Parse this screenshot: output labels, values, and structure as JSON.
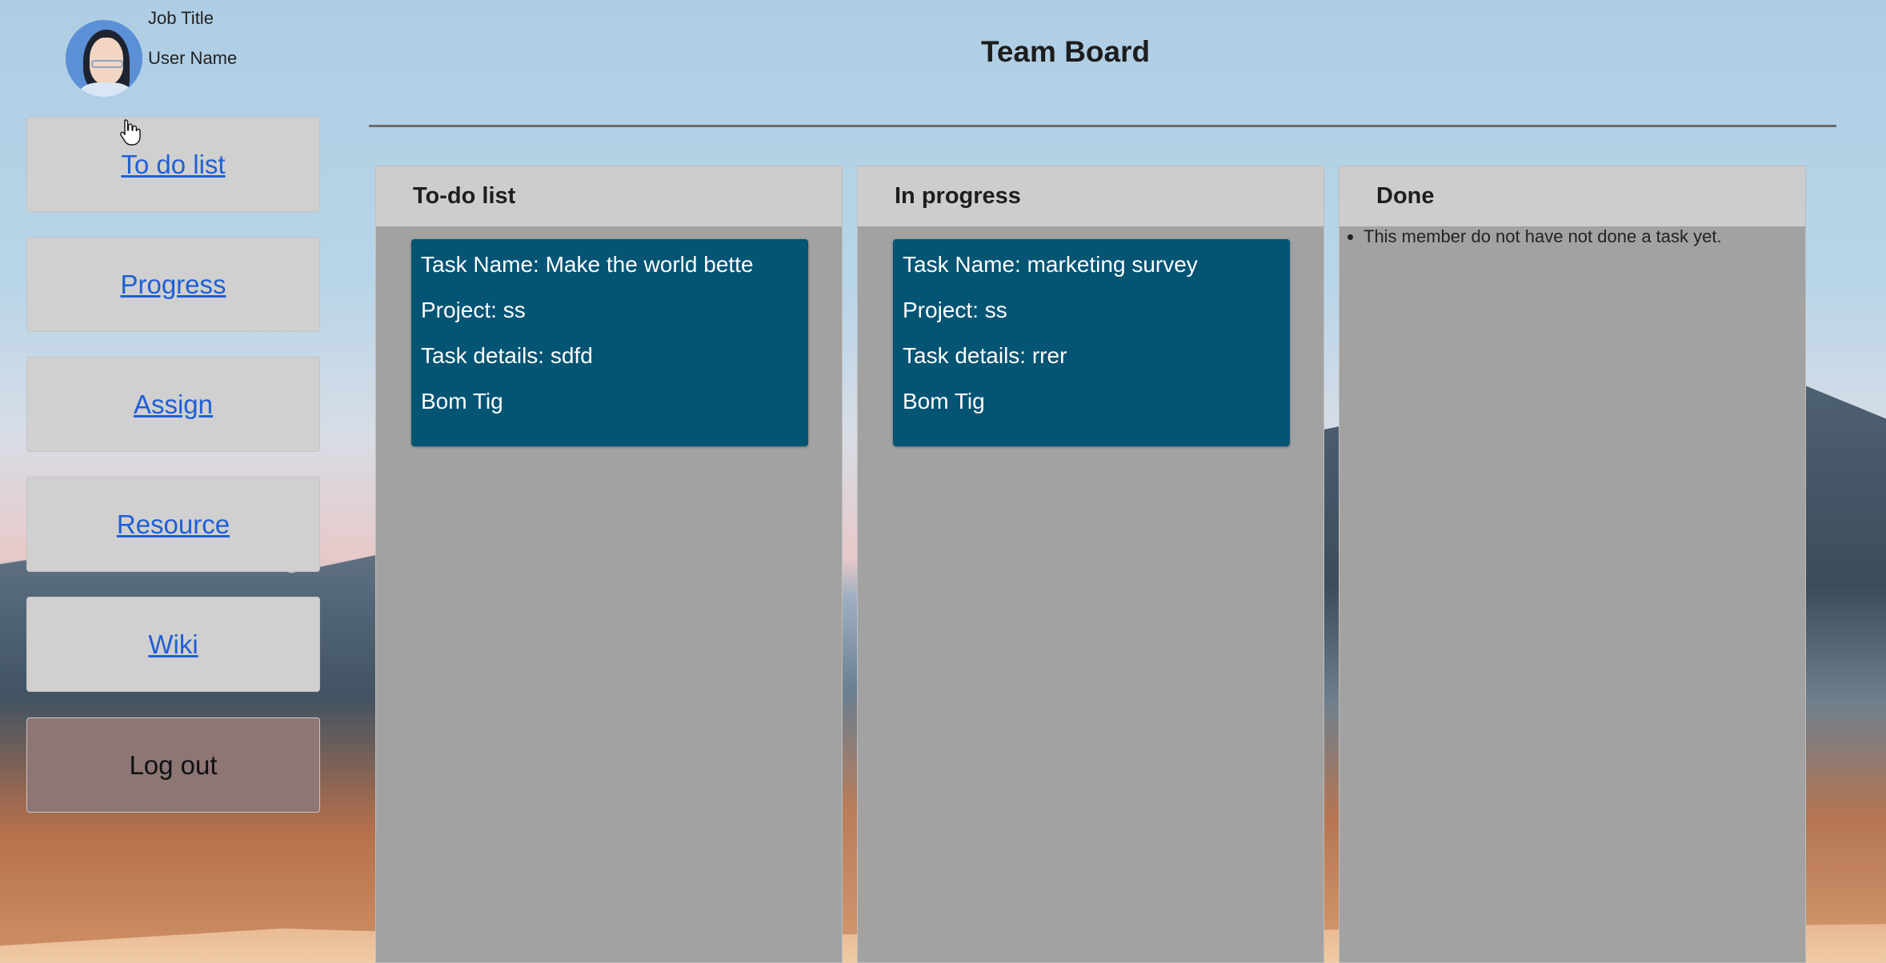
{
  "profile": {
    "job_title": "Job Title",
    "user_name": "User Name"
  },
  "sidebar": {
    "items": [
      {
        "label": "To do list"
      },
      {
        "label": "Progress"
      },
      {
        "label": "Assign"
      },
      {
        "label": "Resource"
      },
      {
        "label": "Wiki"
      }
    ],
    "logout_label": "Log out"
  },
  "header": {
    "title": "Team Board"
  },
  "board": {
    "columns": [
      {
        "title": "To-do list",
        "tasks": [
          {
            "name": "Task Name: Make the world bette",
            "project": "Project: ss",
            "details": "Task details: sdfd",
            "assignee": "Bom Tig"
          }
        ]
      },
      {
        "title": "In progress",
        "tasks": [
          {
            "name": "Task Name: marketing survey",
            "project": "Project: ss",
            "details": "Task details: rrer",
            "assignee": "Bom Tig"
          }
        ]
      },
      {
        "title": "Done",
        "empty_message": "This member do not have not done a task yet."
      }
    ]
  },
  "colors": {
    "card_bg": "#045474",
    "column_bg": "#a2a2a2",
    "column_header_bg": "#cdcdcd",
    "nav_bg": "#d0d0d0",
    "logout_bg": "#8d7674",
    "link": "#1f5fd6"
  }
}
